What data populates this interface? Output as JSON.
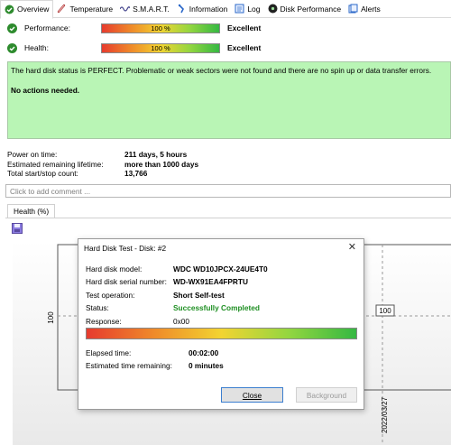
{
  "tabs": [
    {
      "label": "Overview",
      "icon": "check-circle-icon",
      "active": true
    },
    {
      "label": "Temperature",
      "icon": "thermometer-icon"
    },
    {
      "label": "S.M.A.R.T.",
      "icon": "wave-icon"
    },
    {
      "label": "Information",
      "icon": "info-icon"
    },
    {
      "label": "Log",
      "icon": "log-icon"
    },
    {
      "label": "Disk Performance",
      "icon": "disk-icon"
    },
    {
      "label": "Alerts",
      "icon": "alerts-icon"
    }
  ],
  "performance": {
    "label": "Performance:",
    "bar_text": "100 %",
    "value": 100,
    "rating": "Excellent"
  },
  "health": {
    "label": "Health:",
    "bar_text": "100 %",
    "value": 100,
    "rating": "Excellent"
  },
  "status": {
    "message": "The hard disk status is PERFECT. Problematic or weak sectors were not found and there are no spin up or data transfer errors.",
    "action": "No actions needed.",
    "color": "#b9f5b5"
  },
  "info": [
    {
      "key": "Power on time:",
      "value": "211 days, 5 hours"
    },
    {
      "key": "Estimated remaining lifetime:",
      "value": "more than 1000 days"
    },
    {
      "key": "Total start/stop count:",
      "value": "13,766"
    }
  ],
  "comment_placeholder": "Click to add comment ...",
  "health_tab": "Health (%)",
  "chart_data": {
    "type": "line",
    "ytick": "100",
    "point_label": "100",
    "x_label": "2022/03/27",
    "values": [
      100
    ]
  },
  "dialog": {
    "title": "Hard Disk Test - Disk: #2",
    "fields": [
      {
        "key": "Hard disk model:",
        "value": "WDC WD10JPCX-24UE4T0"
      },
      {
        "key": "Hard disk serial number:",
        "value": "WD-WX91EA4FPRTU"
      },
      {
        "key": "Test operation:",
        "value": "Short Self-test"
      },
      {
        "key": "Status:",
        "value": "Successfully Completed"
      },
      {
        "key": "Response:",
        "value": "0x00"
      }
    ],
    "progress": 100,
    "elapsed": {
      "key": "Elapsed time:",
      "value": "00:02:00"
    },
    "remaining": {
      "key": "Estimated time remaining:",
      "value": "0 minutes"
    },
    "close_label": "Close",
    "background_label": "Background",
    "success_color": "#1e8f22"
  }
}
